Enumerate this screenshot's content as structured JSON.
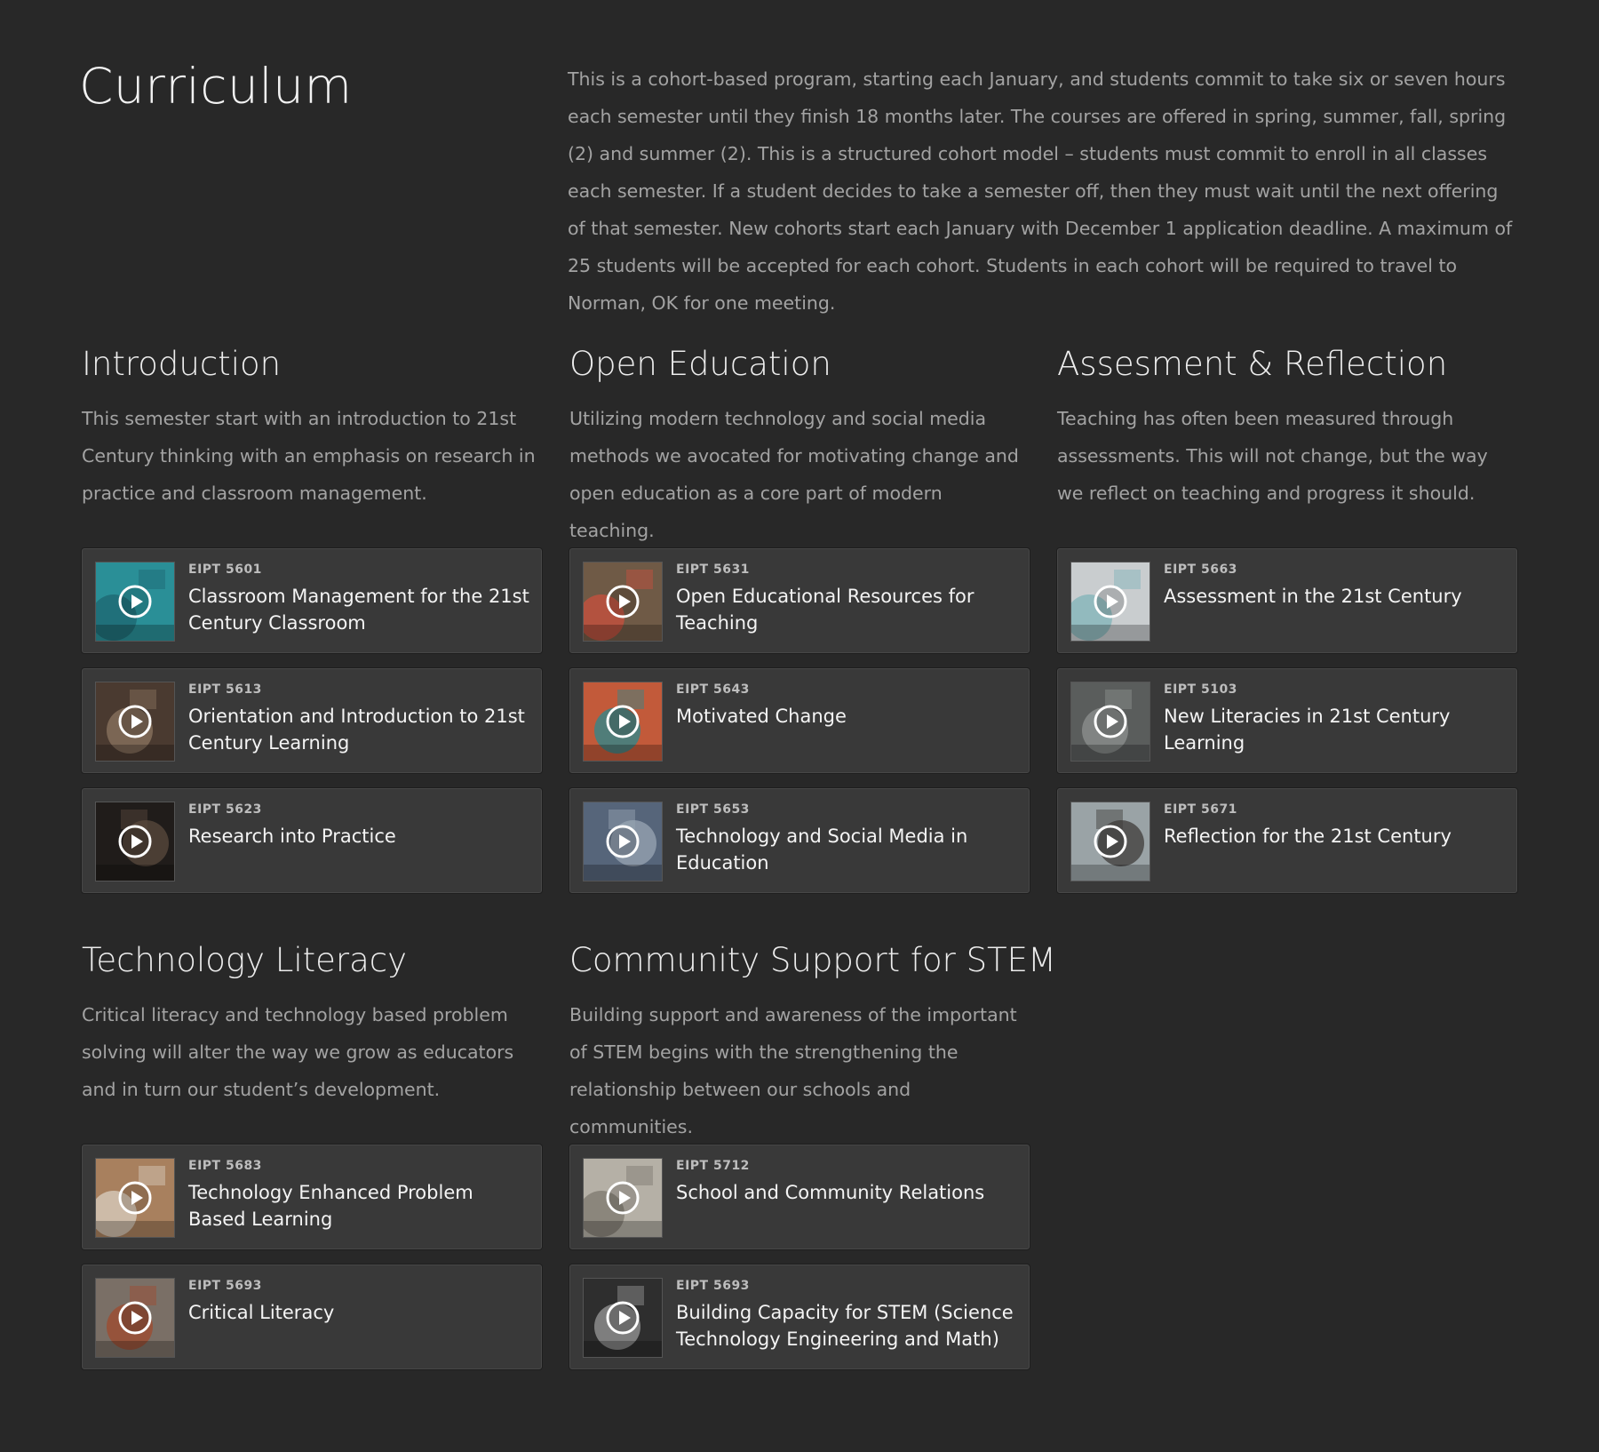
{
  "page": {
    "title": "Curriculum",
    "intro": "This is a cohort-based program, starting each January, and students commit to take six or seven hours each semester until they finish 18 months later. The courses are offered in spring, summer, fall, spring (2) and summer (2). This is a structured cohort model – students must commit to enroll in all classes each semester. If a student decides to take a semester off, then they must wait until the next offering of that semester. New cohorts start each January with December 1 application deadline. A maximum of 25 students will be accepted for each cohort. Students in each cohort will be required to travel to Norman, OK for one meeting."
  },
  "sections": [
    {
      "heading": "Introduction",
      "description": "This semester start with an introduction to 21st Century thinking with an emphasis on research in practice and classroom management.",
      "courses": [
        {
          "code": "EIPT 5601",
          "title": "Classroom Management for the 21st Century Classroom",
          "thumb_color": "#2a8f97",
          "thumb_accent": "#1d6670"
        },
        {
          "code": "EIPT 5613",
          "title": "Orientation and Introduction to 21st Century Learning",
          "thumb_color": "#4a3a30",
          "thumb_accent": "#8c7560"
        },
        {
          "code": "EIPT 5623",
          "title": "Research into Practice",
          "thumb_color": "#201c1a",
          "thumb_accent": "#5a4a3e"
        }
      ]
    },
    {
      "heading": "Open Education",
      "description": "Utilizing modern technology and social media methods we avocated for motivating change and open education as a core part of modern teaching.",
      "courses": [
        {
          "code": "EIPT 5631",
          "title": "Open Educational Resources for Teaching",
          "thumb_color": "#6f5a46",
          "thumb_accent": "#c9503e"
        },
        {
          "code": "EIPT 5643",
          "title": "Motivated Change",
          "thumb_color": "#c25a3a",
          "thumb_accent": "#2a8a8f"
        },
        {
          "code": "EIPT 5653",
          "title": "Technology and Social Media in Education",
          "thumb_color": "#56657a",
          "thumb_accent": "#9aa6b4"
        }
      ]
    },
    {
      "heading": "Assesment & Reflection",
      "description": "Teaching has often been measured through assessments. This will not change, but the way we reflect on teaching and progress it should.",
      "courses": [
        {
          "code": "EIPT 5663",
          "title": "Assessment in the 21st Century",
          "thumb_color": "#c9cdcf",
          "thumb_accent": "#7fb3b8"
        },
        {
          "code": "EIPT 5103",
          "title": "New Literacies in 21st Century Learning",
          "thumb_color": "#5a5d5c",
          "thumb_accent": "#8f9290"
        },
        {
          "code": "EIPT 5671",
          "title": "Reflection for the 21st Century",
          "thumb_color": "#9aa3a6",
          "thumb_accent": "#3d3b38"
        }
      ]
    },
    {
      "heading": "Technology Literacy",
      "description": "Critical literacy and technology based problem solving will alter the way we grow as educators and in turn our student’s development.",
      "courses": [
        {
          "code": "EIPT 5683",
          "title": "Technology Enhanced Problem Based Learning",
          "thumb_color": "#a8805e",
          "thumb_accent": "#d9cfc2"
        },
        {
          "code": "EIPT 5693",
          "title": "Critical Literacy",
          "thumb_color": "#7a6f66",
          "thumb_accent": "#a04a2e"
        }
      ]
    },
    {
      "heading": "Community Support for STEM",
      "description": "Building support and awareness of the important of STEM begins with the strengthening the relationship between our schools and communities.",
      "courses": [
        {
          "code": "EIPT 5712",
          "title": "School and Community Relations",
          "thumb_color": "#b5b0a6",
          "thumb_accent": "#7d786e"
        },
        {
          "code": "EIPT 5693",
          "title": "Building Capacity for STEM (Science Technology  Engineering and Math)",
          "thumb_color": "#2e2e2e",
          "thumb_accent": "#9a9a9a"
        }
      ]
    }
  ]
}
